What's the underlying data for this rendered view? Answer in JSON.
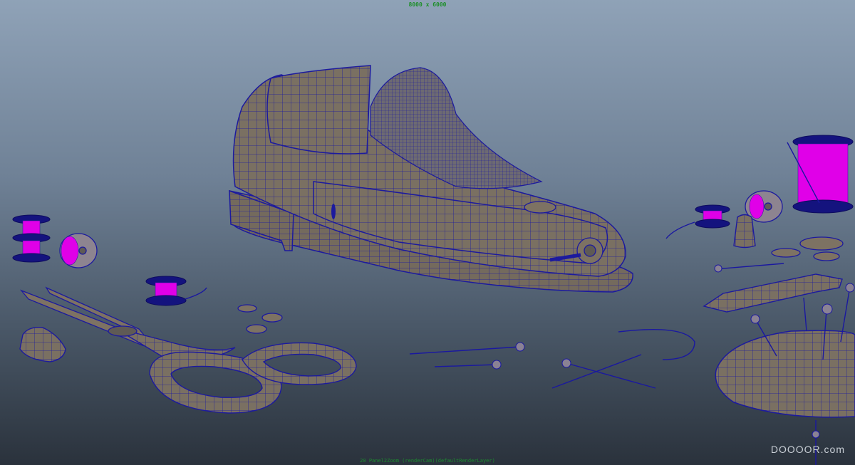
{
  "viewport": {
    "resolution_label": "8000 x 6000",
    "status_line": "20 Panel2Zoom  (renderCam)(defaultRenderLayer)",
    "watermark": "DOOOOR.com",
    "colors": {
      "background_top": "#8fa2b7",
      "background_bottom": "#2a323c",
      "wireframe": "#1c1a9e",
      "surface": "#7d7263",
      "thread": "#e000e8",
      "hud_text": "#1e8f2a"
    }
  }
}
